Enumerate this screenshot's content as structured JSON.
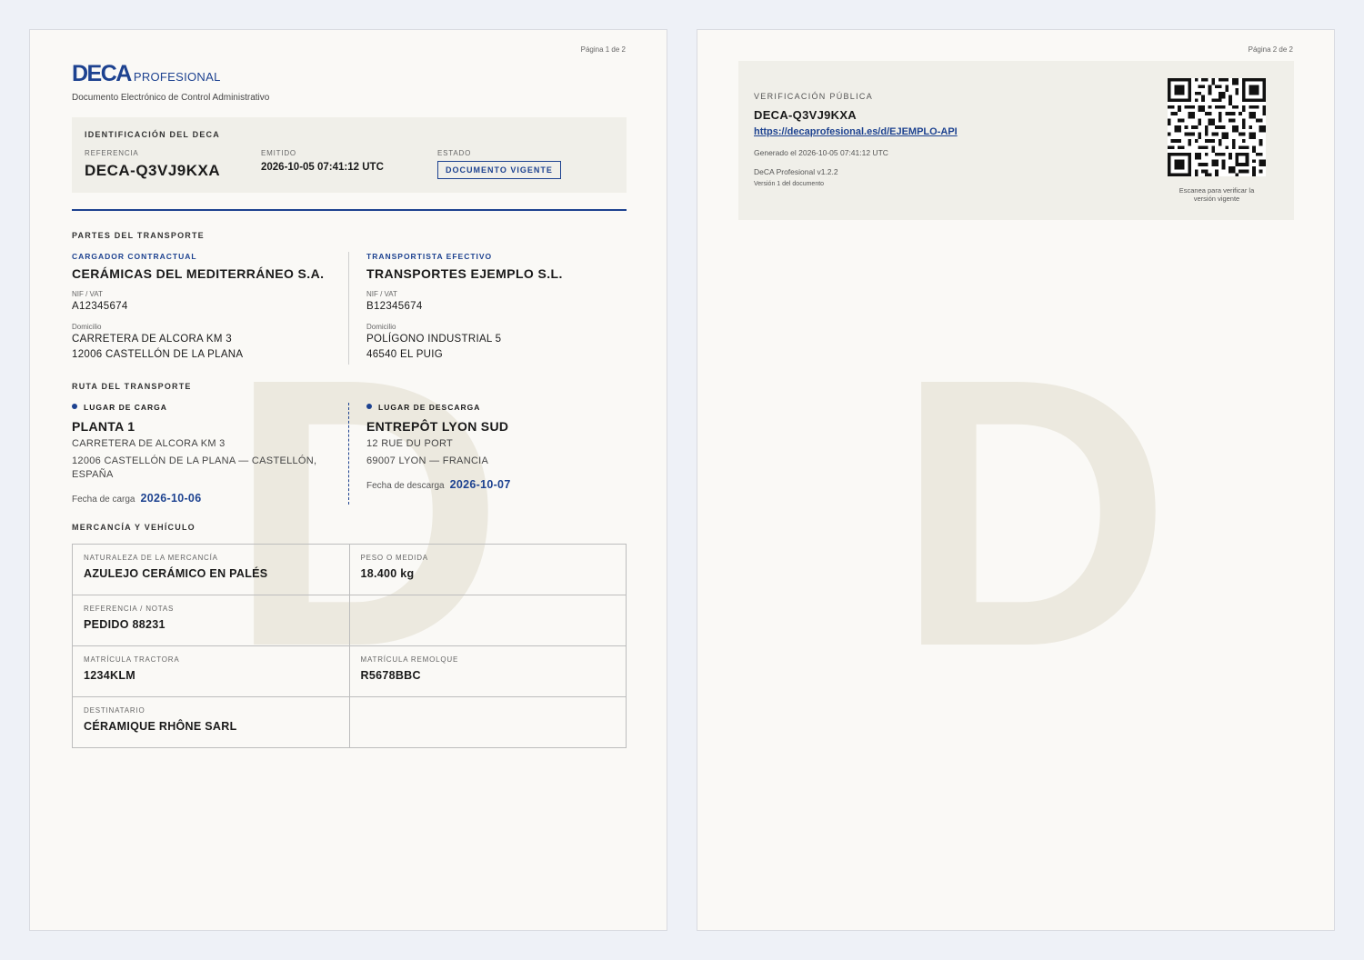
{
  "page1": {
    "page_number": "Página 1 de 2",
    "logo": {
      "brand": "DECA",
      "suffix": "PROFESIONAL"
    },
    "subtitle": "Documento Electrónico de Control Administrativo",
    "identification": {
      "title": "IDENTIFICACIÓN DEL DECA",
      "reference_label": "REFERENCIA",
      "reference": "DECA-Q3VJ9KXA",
      "issued_label": "EMITIDO",
      "issued": "2026-10-05 07:41:12 UTC",
      "status_label": "ESTADO",
      "status": "DOCUMENTO VIGENTE"
    },
    "parties": {
      "title": "PARTES DEL TRANSPORTE",
      "shipper": {
        "role": "CARGADOR CONTRACTUAL",
        "name": "CERÁMICAS DEL MEDITERRÁNEO S.A.",
        "tax_label": "NIF / VAT",
        "tax_id": "A12345674",
        "address_label": "Domicilio",
        "address_line1": "CARRETERA DE ALCORA KM 3",
        "address_line2": "12006 CASTELLÓN DE LA PLANA"
      },
      "carrier": {
        "role": "TRANSPORTISTA EFECTIVO",
        "name": "TRANSPORTES EJEMPLO S.L.",
        "tax_label": "NIF / VAT",
        "tax_id": "B12345674",
        "address_label": "Domicilio",
        "address_line1": "POLÍGONO INDUSTRIAL 5",
        "address_line2": "46540 EL PUIG"
      }
    },
    "route": {
      "title": "RUTA DEL TRANSPORTE",
      "loading": {
        "label": "LUGAR DE CARGA",
        "name": "PLANTA 1",
        "address_line1": "CARRETERA DE ALCORA KM 3",
        "address_line2": "12006 CASTELLÓN DE LA PLANA — CASTELLÓN,",
        "address_line3": "ESPAÑA",
        "date_label": "Fecha de carga",
        "date": "2026-10-06"
      },
      "unloading": {
        "label": "LUGAR DE DESCARGA",
        "name": "ENTREPÔT LYON SUD",
        "address_line1": "12 RUE DU PORT",
        "address_line2": "69007 LYON — FRANCIA",
        "date_label": "Fecha de descarga",
        "date": "2026-10-07"
      }
    },
    "goods": {
      "title": "MERCANCÍA Y VEHÍCULO",
      "nature_label": "NATURALEZA DE LA MERCANCÍA",
      "nature": "AZULEJO CERÁMICO EN PALÉS",
      "weight_label": "PESO O MEDIDA",
      "weight": "18.400 kg",
      "ref_label": "REFERENCIA / NOTAS",
      "ref": "PEDIDO 88231",
      "tractor_label": "MATRÍCULA TRACTORA",
      "tractor": "1234KLM",
      "trailer_label": "MATRÍCULA REMOLQUE",
      "trailer": "R5678BBC",
      "recipient_label": "DESTINATARIO",
      "recipient": "CÉRAMIQUE RHÔNE SARL"
    },
    "watermark": "D"
  },
  "page2": {
    "page_number": "Página 2 de 2",
    "verification": {
      "title": "VERIFICACIÓN PÚBLICA",
      "reference": "DECA-Q3VJ9KXA",
      "url": "https://decaprofesional.es/d/EJEMPLO-API",
      "generated": "Generado el 2026-10-05 07:41:12 UTC",
      "software": "DeCA Profesional v1.2.2",
      "version": "Versión 1 del documento",
      "qr_caption_line1": "Escanea para verificar la",
      "qr_caption_line2": "versión vigente"
    },
    "watermark": "D"
  },
  "colors": {
    "brand": "#1d4290",
    "paper": "#faf9f6",
    "panel": "#f0efe9",
    "watermark": "#ece9df"
  }
}
